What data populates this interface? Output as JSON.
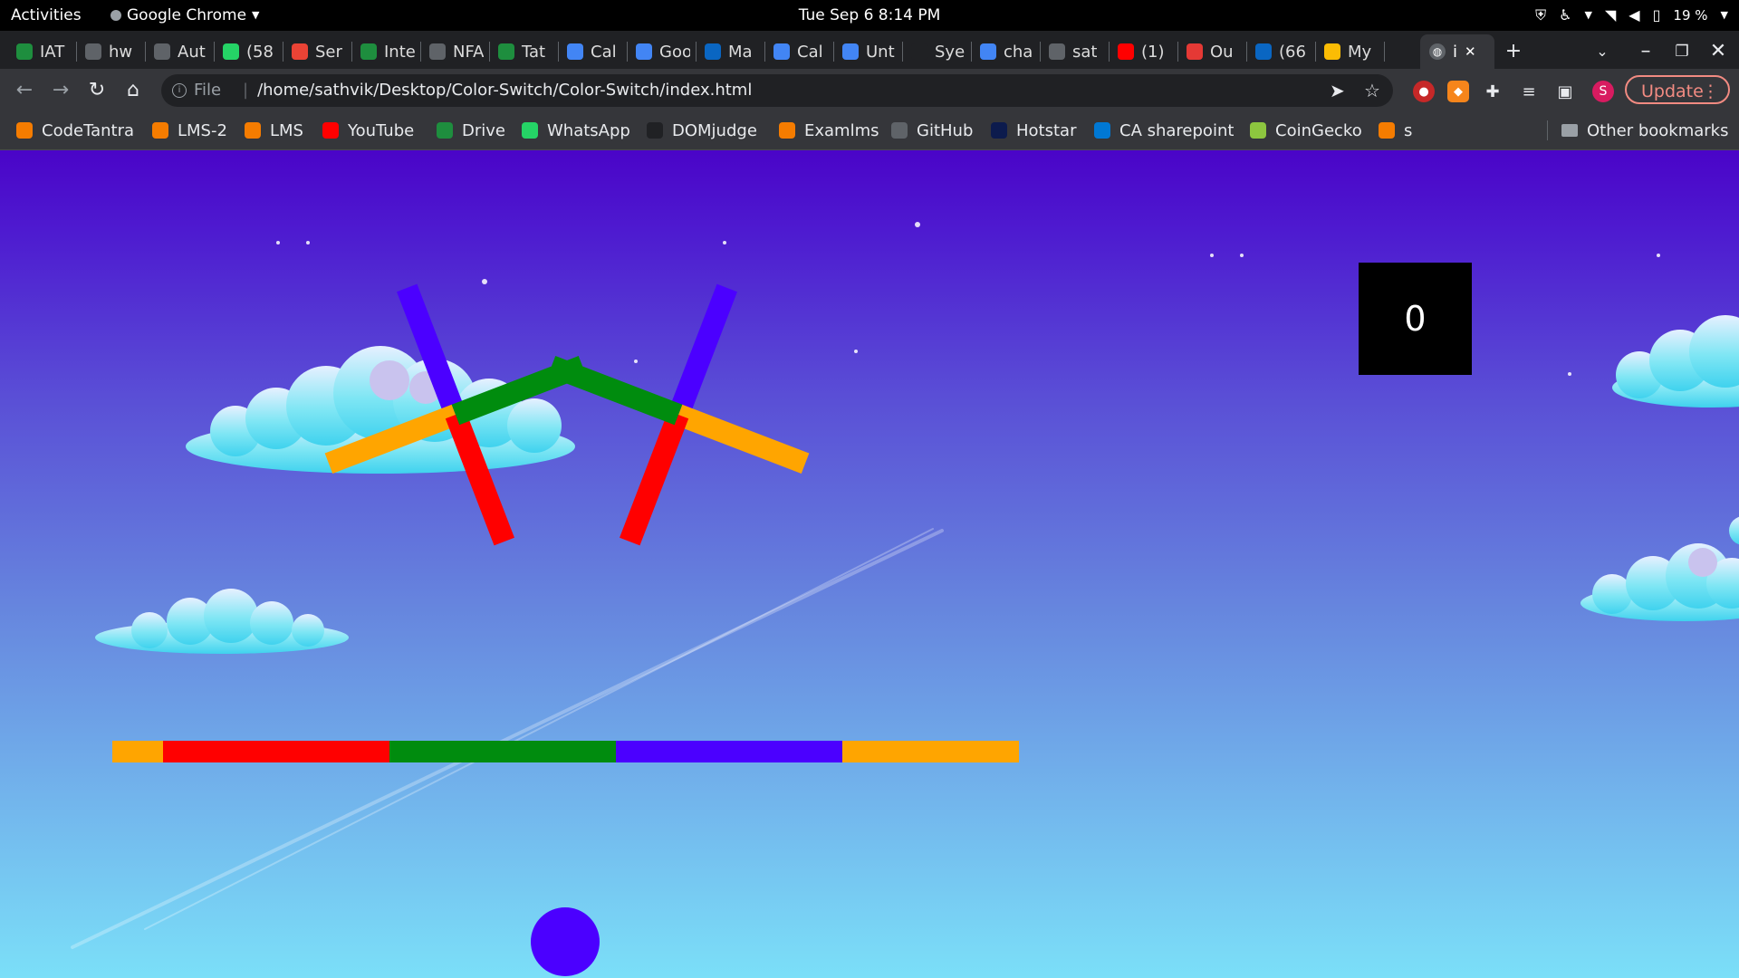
{
  "topbar": {
    "activities": "Activities",
    "app_name": "Google Chrome",
    "clock": "Tue Sep 6  8:14 PM",
    "battery": "19 %"
  },
  "tabs": [
    {
      "label": "IAT",
      "icon": "codetantra-icon",
      "color": "#1e8e3e"
    },
    {
      "label": "hw",
      "icon": "globe-icon",
      "color": "#5f6368"
    },
    {
      "label": "Aut",
      "icon": "globe-icon",
      "color": "#5f6368"
    },
    {
      "label": "(58",
      "icon": "whatsapp-icon",
      "color": "#25d366"
    },
    {
      "label": "Ser",
      "icon": "maps-icon",
      "color": "#ea4335"
    },
    {
      "label": "Inte",
      "icon": "codetantra-icon",
      "color": "#1e8e3e"
    },
    {
      "label": "NFA",
      "icon": "globe-icon",
      "color": "#5f6368"
    },
    {
      "label": "Tat",
      "icon": "codetantra-icon",
      "color": "#1e8e3e"
    },
    {
      "label": "Cal",
      "icon": "docs-icon",
      "color": "#4285f4"
    },
    {
      "label": "Goo",
      "icon": "google-icon",
      "color": "#4285f4"
    },
    {
      "label": "Ma",
      "icon": "outlook-icon",
      "color": "#0a66c2"
    },
    {
      "label": "Cal",
      "icon": "docs-icon",
      "color": "#4285f4"
    },
    {
      "label": "Unt",
      "icon": "docs-icon",
      "color": "#4285f4"
    },
    {
      "label": "Sye",
      "icon": "s-icon",
      "color": "#202124"
    },
    {
      "label": "cha",
      "icon": "google-icon",
      "color": "#4285f4"
    },
    {
      "label": "sat",
      "icon": "github-icon",
      "color": "#5f6368"
    },
    {
      "label": "(1)",
      "icon": "youtube-icon",
      "color": "#ff0000"
    },
    {
      "label": "Ou",
      "icon": "t-icon",
      "color": "#e53935"
    },
    {
      "label": "(66",
      "icon": "linkedin-icon",
      "color": "#0a66c2"
    },
    {
      "label": "My",
      "icon": "drive-icon",
      "color": "#fbbc04"
    }
  ],
  "active_tab": {
    "label": "i",
    "close": "✕"
  },
  "toolbar": {
    "info_label": "File",
    "url": "/home/sathvik/Desktop/Color-Switch/Color-Switch/index.html",
    "profile_initial": "S",
    "update_label": "Update"
  },
  "bookmarks": [
    {
      "label": "CodeTantra",
      "icon": "codetantra-icon",
      "color": "#f57c00"
    },
    {
      "label": "LMS-2",
      "icon": "lms-icon",
      "color": "#f57c00"
    },
    {
      "label": "LMS",
      "icon": "lms-icon",
      "color": "#f57c00"
    },
    {
      "label": "YouTube",
      "icon": "youtube-icon",
      "color": "#ff0000"
    },
    {
      "label": "Drive",
      "icon": "drive-icon",
      "color": "#1e8e3e"
    },
    {
      "label": "WhatsApp",
      "icon": "whatsapp-icon",
      "color": "#25d366"
    },
    {
      "label": "DOMjudge",
      "icon": "domjudge-icon",
      "color": "#202124"
    },
    {
      "label": "Examlms",
      "icon": "lms-icon",
      "color": "#f57c00"
    },
    {
      "label": "GitHub",
      "icon": "github-icon",
      "color": "#5f6368"
    },
    {
      "label": "Hotstar",
      "icon": "hotstar-icon",
      "color": "#0c1b4d"
    },
    {
      "label": "CA sharepoint",
      "icon": "onedrive-icon",
      "color": "#0078d4"
    },
    {
      "label": "CoinGecko",
      "icon": "coingecko-icon",
      "color": "#8dc63f"
    },
    {
      "label": "s",
      "icon": "codetantra-icon",
      "color": "#f57c00"
    }
  ],
  "other_bookmarks": "Other bookmarks",
  "game": {
    "score": "0",
    "colors": {
      "orange": "#ffa500",
      "red": "#ff0000",
      "green": "#008c0e",
      "purple": "#4b00ff"
    },
    "ball_color": "#4b00ff",
    "bar_color_order": [
      "orange",
      "red",
      "green",
      "purple",
      "orange"
    ]
  }
}
